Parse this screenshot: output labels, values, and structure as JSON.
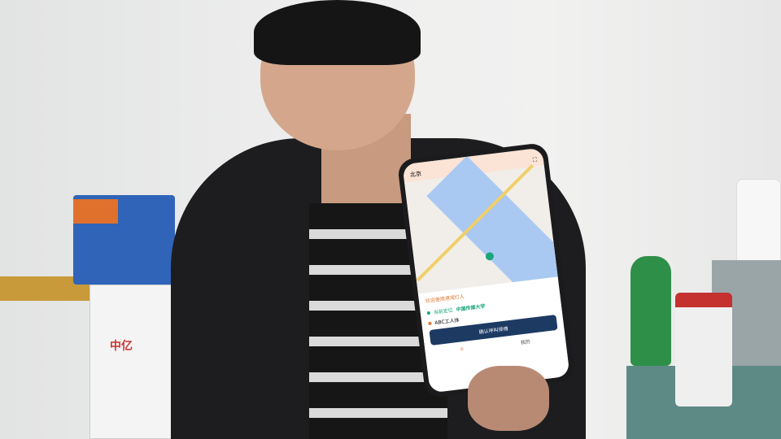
{
  "photo": {
    "freezer_brand": "中亿"
  },
  "phone": {
    "city": "北京",
    "welcome": "欢迎使用港湾打人",
    "from_label": "当前定位",
    "from_place": "中国传媒大学",
    "to_place": "ABC工人体",
    "confirm_button": "确认呼叫师傅",
    "tab_me": "我的",
    "colors": {
      "accent": "#e0732c",
      "primary": "#1d3a63",
      "green": "#1aa57a"
    }
  }
}
